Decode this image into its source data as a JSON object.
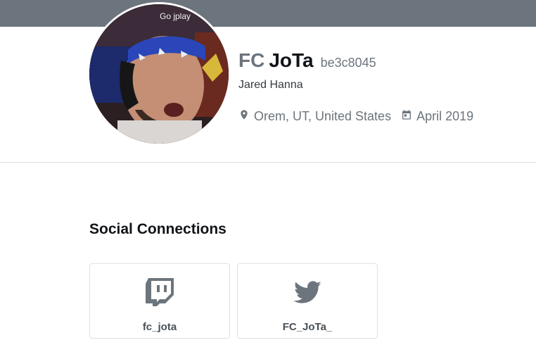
{
  "banner": {
    "color": "#6c757d"
  },
  "avatar": {
    "overlay_text": "Go jplay"
  },
  "profile": {
    "name_prefix": "FC",
    "name_main": "JoTa",
    "name_hash": "be3c8045",
    "real_name": "Jared Hanna",
    "location": "Orem, UT, United States",
    "joined": "April 2019"
  },
  "social": {
    "title": "Social Connections",
    "connections": [
      {
        "platform": "twitch",
        "icon": "twitch-icon",
        "handle": "fc_jota"
      },
      {
        "platform": "twitter",
        "icon": "twitter-icon",
        "handle": "FC_JoTa_"
      }
    ]
  },
  "colors": {
    "muted": "#6c757d",
    "text": "#111418",
    "border": "#dee2e6"
  }
}
